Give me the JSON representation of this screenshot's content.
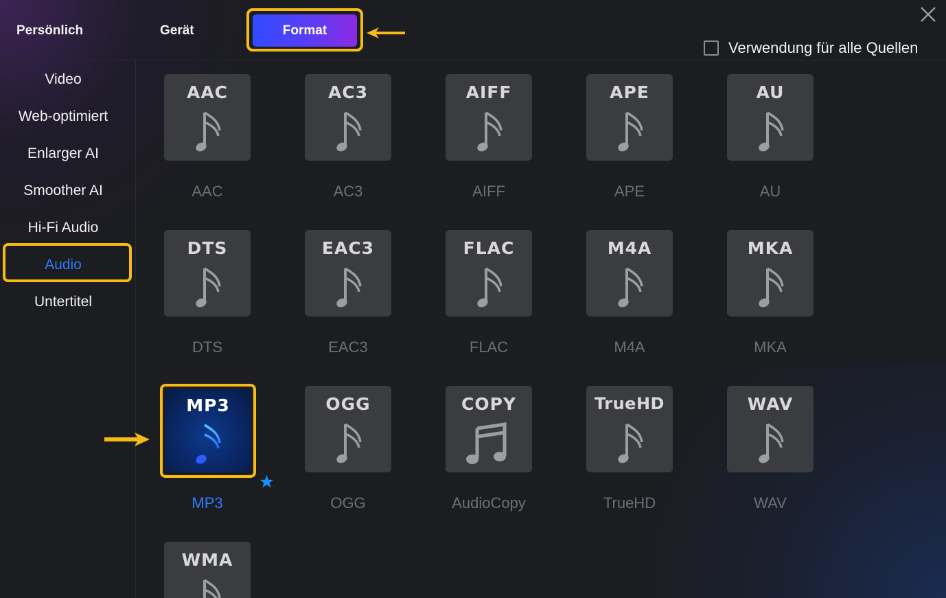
{
  "header": {
    "tabs": [
      "Persönlich",
      "Gerät",
      "Format"
    ],
    "active_tab": "Format",
    "apply_all_label": "Verwendung für alle Quellen",
    "apply_all_checked": false
  },
  "sidebar": {
    "items": [
      "Video",
      "Web-optimiert",
      "Enlarger AI",
      "Smoother AI",
      "Hi-Fi Audio",
      "Audio",
      "Untertitel"
    ],
    "active": "Audio"
  },
  "formats": [
    {
      "title": "AAC",
      "label": "AAC"
    },
    {
      "title": "AC3",
      "label": "AC3"
    },
    {
      "title": "AIFF",
      "label": "AIFF"
    },
    {
      "title": "APE",
      "label": "APE"
    },
    {
      "title": "AU",
      "label": "AU"
    },
    {
      "title": "DTS",
      "label": "DTS"
    },
    {
      "title": "EAC3",
      "label": "EAC3"
    },
    {
      "title": "FLAC",
      "label": "FLAC"
    },
    {
      "title": "M4A",
      "label": "M4A"
    },
    {
      "title": "MKA",
      "label": "MKA"
    },
    {
      "title": "MP3",
      "label": "MP3",
      "selected": true,
      "favorite": true
    },
    {
      "title": "OGG",
      "label": "OGG"
    },
    {
      "title": "COPY",
      "label": "AudioCopy",
      "icon": "double-note-icon"
    },
    {
      "title": "TrueHD",
      "label": "TrueHD"
    },
    {
      "title": "WAV",
      "label": "WAV"
    },
    {
      "title": "WMA",
      "label": ""
    }
  ],
  "colors": {
    "accent": "#2f7bff",
    "highlight": "#f6bb15",
    "tile": "#3b3c40",
    "background": "#1c1d21"
  }
}
